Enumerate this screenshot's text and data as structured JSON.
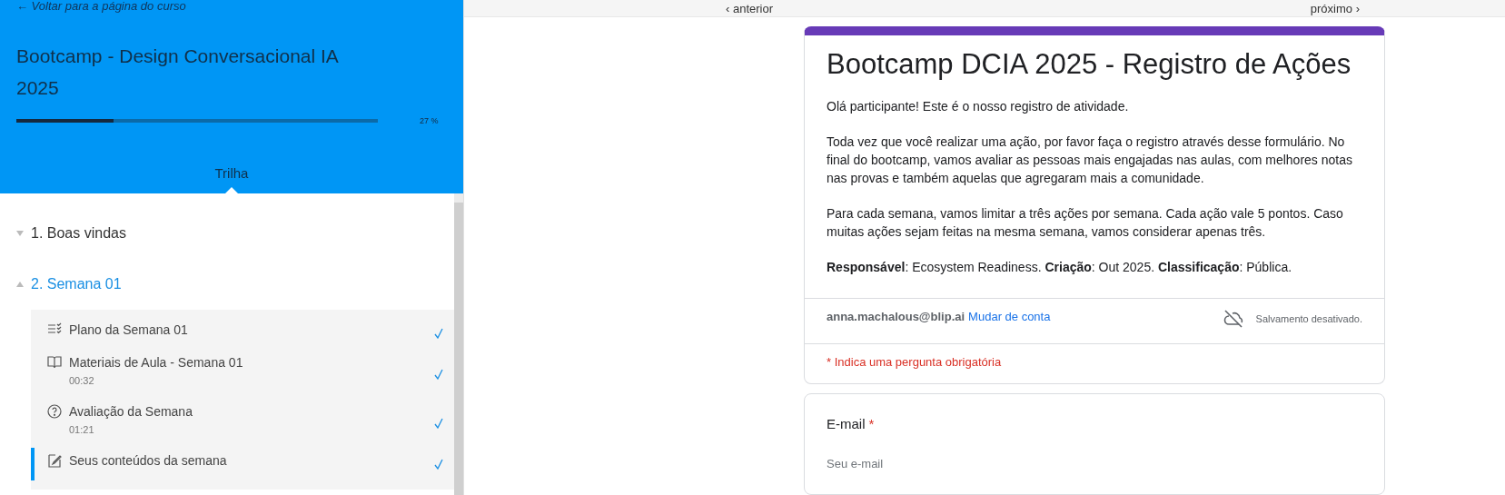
{
  "sidebar": {
    "back_link": "← Voltar para a página do curso",
    "course_title": "Bootcamp - Design Conversacional IA 2025",
    "progress": {
      "level": 0.27,
      "reading": "27 %"
    },
    "tabs": [
      {
        "label": "Trilha",
        "selected": true
      }
    ],
    "sections": [
      {
        "title": "1. Boas vindas",
        "expanded": false
      },
      {
        "title": "2. Semana 01",
        "expanded": true,
        "lessons": [
          {
            "kind": "checklist",
            "title": "Plano da Semana 01",
            "completed": true,
            "selected": false
          },
          {
            "kind": "reading",
            "title": "Materiais de Aula - Semana 01",
            "duration": "00:32",
            "completed": true,
            "selected": false
          },
          {
            "kind": "quiz",
            "title": "Avaliação da Semana",
            "duration": "01:21",
            "completed": true,
            "selected": false
          },
          {
            "kind": "task",
            "title": "Seus conteúdos da semana",
            "completed": true,
            "selected": true
          }
        ]
      }
    ]
  },
  "nav": {
    "previous": "‹ anterior",
    "next": "próximo ›"
  },
  "form": {
    "title": "Bootcamp DCIA 2025 - Registro de Ações",
    "description": [
      "Olá participante! Este é o nosso registro de atividade.",
      "Toda vez que você realizar uma ação, por favor faça o registro através desse formulário. No final do bootcamp, vamos avaliar as pessoas mais engajadas nas aulas, com melhores notas nas provas e também aquelas que agregaram mais a comunidade.",
      "Para cada semana, vamos limitar a três ações por semana. Cada ação vale 5 pontos. Caso muitas ações sejam feitas na mesma semana, vamos considerar apenas três.",
      "**Responsável**: Ecosystem Readiness. **Criação**: Out 2025. **Classificação**: Pública."
    ],
    "account": "anna.machalous@blip.ai",
    "switch_account": "Mudar de conta",
    "save_status": "Salvamento desativado.",
    "required_note": "* Indica uma pergunta obrigatória",
    "questions": [
      {
        "label": "E-mail",
        "required_mark": "*",
        "placeholder": "Seu e-mail"
      }
    ]
  }
}
